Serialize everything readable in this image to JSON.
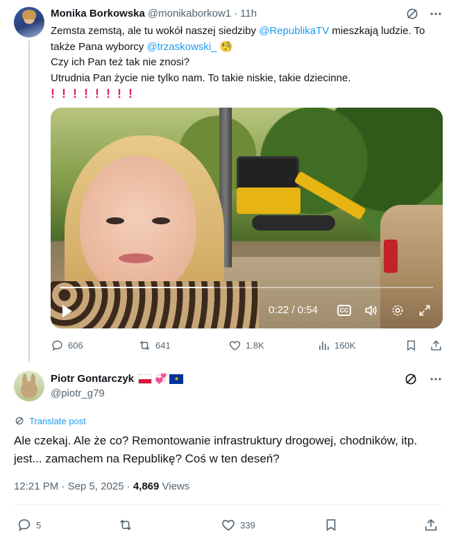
{
  "quoted_tweet": {
    "display_name": "Monika Borkowska",
    "handle": "@monikaborkow1",
    "separator": "·",
    "time": "11h",
    "text_line1_a": "Zemsta zemstą, ale tu wokół naszej siedziby ",
    "mention1": "@RepublikaTV",
    "text_line1_b": "  mieszkają ludzie. To także Pana wyborcy ",
    "mention2": "@trzaskowski_",
    "emoji_monocle": "🧐",
    "text_line2": "Czy ich Pan też tak nie znosi?",
    "text_line3": "Utrudnia Pan życie nie tylko nam. To takie niskie, takie dziecinne.",
    "exclamations": "!!!!!!!!",
    "video": {
      "time_current": "0:22",
      "time_separator": "/",
      "time_total": "0:54",
      "cc_label": "CC",
      "progress_fraction": 0.41
    },
    "actions": {
      "replies": "606",
      "reposts": "641",
      "likes": "1.8K",
      "views": "160K"
    }
  },
  "main_tweet": {
    "display_name": "Piotr Gontarczyk",
    "hearts_emoji": "💞",
    "eu_flag_stars": "★",
    "handle": "@piotr_g79",
    "translate_label": "Translate post",
    "text": "Ale czekaj. Ale że co? Remontowanie infrastruktury drogowej, chodników, itp. jest... zamachem na Republikę? Coś w ten deseń?",
    "time": "12:21 PM",
    "date": "Sep 5, 2025",
    "meta_separator": "·",
    "views_count": "4,869",
    "views_label": "Views",
    "actions": {
      "replies": "5",
      "likes": "339"
    }
  },
  "colors": {
    "accent": "#1d9bf0",
    "muted": "#536471",
    "text": "#0f1419",
    "thread_line": "#cfd9de"
  },
  "icons": [
    "grok-icon",
    "more-icon",
    "reply-icon",
    "repost-icon",
    "like-icon",
    "views-icon",
    "bookmark-icon",
    "share-icon",
    "play-icon",
    "cc-icon",
    "volume-icon",
    "settings-icon",
    "fullscreen-icon",
    "translate-icon"
  ]
}
